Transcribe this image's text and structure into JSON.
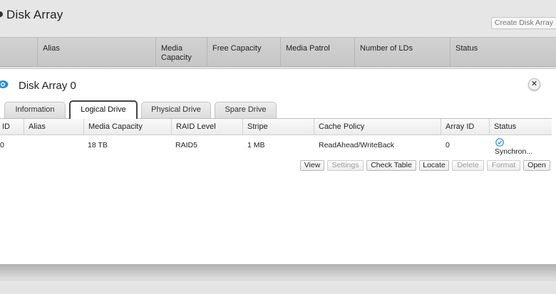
{
  "page": {
    "title": "Disk Array",
    "create_button": "Create Disk Array"
  },
  "outer_table": {
    "headers": [
      "Alias",
      "Media Capacity",
      "Free Capacity",
      "Media Patrol",
      "Number of LDs",
      "Status"
    ]
  },
  "panel": {
    "title": "Disk Array 0",
    "close_glyph": "✕",
    "tabs": [
      {
        "label": "Information",
        "active": false
      },
      {
        "label": "Logical Drive",
        "active": true
      },
      {
        "label": "Physical Drive",
        "active": false
      },
      {
        "label": "Spare Drive",
        "active": false
      }
    ],
    "table": {
      "headers": [
        "ID",
        "Alias",
        "Media Capacity",
        "RAID Level",
        "Stripe",
        "Cache Policy",
        "Array ID",
        "Status"
      ],
      "rows": [
        {
          "id": "0",
          "alias": "",
          "media_capacity": "18 TB",
          "raid_level": "RAID5",
          "stripe": "1 MB",
          "cache_policy": "ReadAhead/WriteBack",
          "array_id": "0",
          "status": "Synchron..."
        }
      ]
    },
    "actions": [
      {
        "label": "View",
        "enabled": true
      },
      {
        "label": "Settings",
        "enabled": false
      },
      {
        "label": "Check Table",
        "enabled": true
      },
      {
        "label": "Locate",
        "enabled": true
      },
      {
        "label": "Delete",
        "enabled": false
      },
      {
        "label": "Format",
        "enabled": false
      },
      {
        "label": "Open",
        "enabled": true
      }
    ]
  },
  "icons": {
    "eye": "eye-icon",
    "close": "close-icon",
    "status": "check-circle-icon"
  },
  "colors": {
    "accent_blue": "#2a8fd6",
    "active_tab_border": "#444444"
  }
}
